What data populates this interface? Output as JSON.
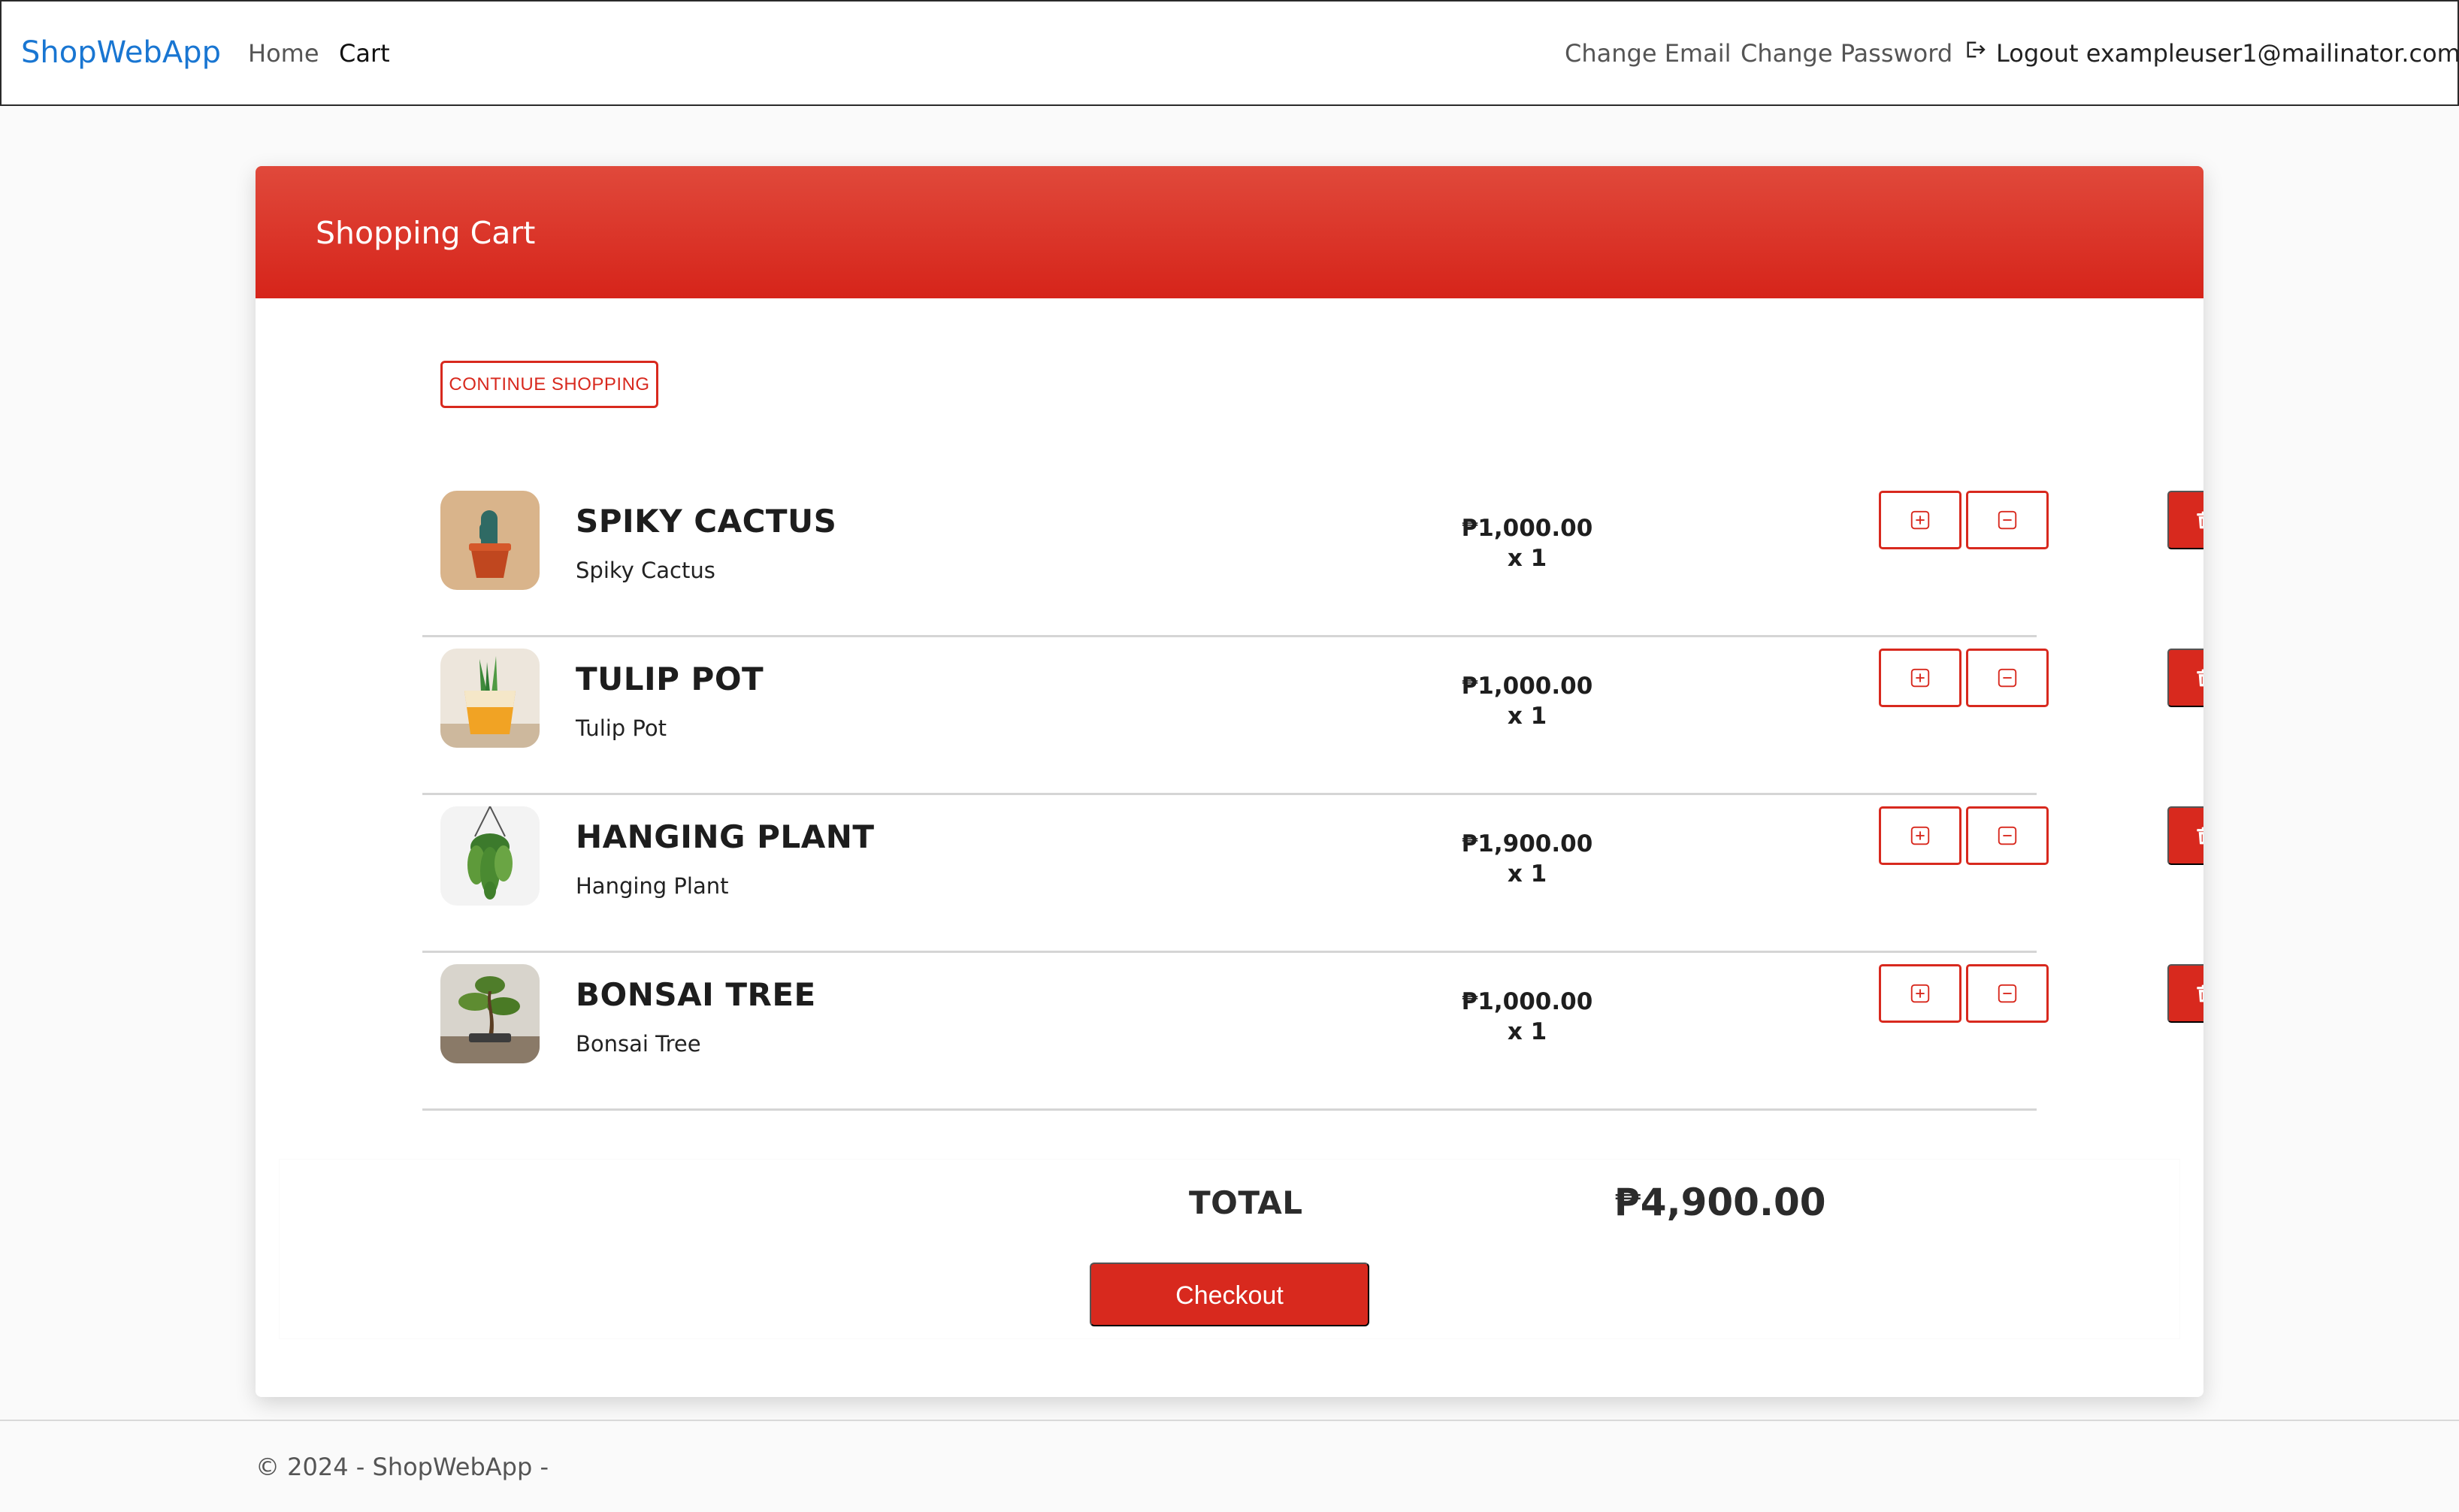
{
  "navbar": {
    "brand": "ShopWebApp",
    "links": {
      "home": "Home",
      "cart": "Cart",
      "change_email": "Change Email",
      "change_password": "Change Password",
      "logout": "Logout exampleuser1@mailinator.com"
    }
  },
  "cart": {
    "title": "Shopping Cart",
    "continue_label": "CONTINUE SHOPPING",
    "items": [
      {
        "name": "SPIKY CACTUS",
        "subtitle": "Spiky Cactus",
        "price": "₱1,000.00",
        "qty": "x 1",
        "image": "cactus-image"
      },
      {
        "name": "TULIP POT",
        "subtitle": "Tulip Pot",
        "price": "₱1,000.00",
        "qty": "x 1",
        "image": "tulip-pot-image"
      },
      {
        "name": "HANGING PLANT",
        "subtitle": "Hanging Plant",
        "price": "₱1,900.00",
        "qty": "x 1",
        "image": "hanging-plant-image"
      },
      {
        "name": "BONSAI TREE",
        "subtitle": "Bonsai Tree",
        "price": "₱1,000.00",
        "qty": "x 1",
        "image": "bonsai-image"
      }
    ],
    "total_label": "TOTAL",
    "total_value": "₱4,900.00",
    "checkout_label": "Checkout"
  },
  "footer": {
    "text": "© 2024 - ShopWebApp -"
  },
  "colors": {
    "accent": "#d8291e",
    "brand": "#1976d2"
  }
}
